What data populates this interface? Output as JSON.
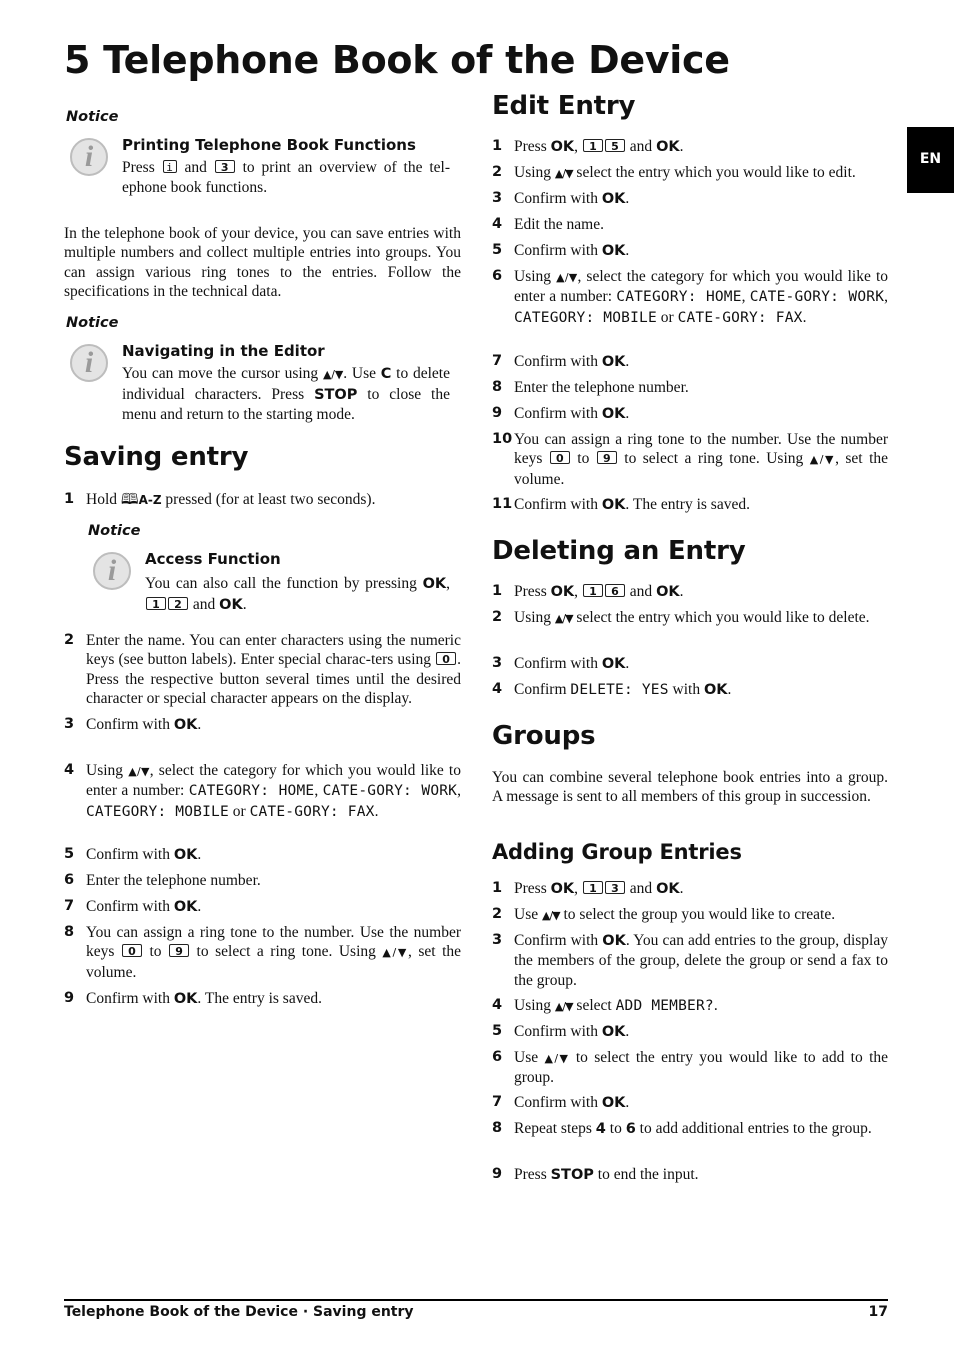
{
  "page_title": "5  Telephone Book of the Device",
  "lang_tab": "EN",
  "left": {
    "notice1": {
      "label": "Notice",
      "title": "Printing Telephone Book Functions",
      "body": [
        [
          "t",
          "Press "
        ],
        [
          "ks",
          "i"
        ],
        [
          "t",
          " and "
        ],
        [
          "k",
          "3"
        ],
        [
          "t",
          " to print an overview of the tel-ephone book functions."
        ]
      ]
    },
    "intro": "In the telephone book of your device, you can save entries with multiple numbers and collect multiple entries into groups. You can assign various ring tones to the entries. Follow the specifications in the technical data.",
    "notice2": {
      "label": "Notice",
      "title": "Navigating in the Editor",
      "body": [
        [
          "t",
          "You can move the cursor using "
        ],
        [
          "a",
          "▲/▼"
        ],
        [
          "t",
          ". Use "
        ],
        [
          "b",
          "C"
        ],
        [
          "t",
          " to delete individual characters. Press "
        ],
        [
          "b",
          "STOP"
        ],
        [
          "t",
          " to close the menu and return to the starting mode."
        ]
      ]
    },
    "saving": {
      "heading": "Saving entry",
      "step1": {
        "num": "1",
        "text": [
          [
            "t",
            "Hold "
          ],
          [
            "book",
            "🕮"
          ],
          [
            "az",
            "A-Z"
          ],
          [
            "t",
            " pressed (for at least two seconds)."
          ]
        ]
      },
      "notice3": {
        "label": "Notice",
        "title": "Access Function",
        "body": [
          [
            "t",
            "You can also call the function by pressing "
          ],
          [
            "b",
            "OK"
          ],
          [
            "t",
            ", "
          ],
          [
            "k",
            "1"
          ],
          [
            "k",
            "2"
          ],
          [
            "t",
            " and "
          ],
          [
            "b",
            "OK"
          ],
          [
            "t",
            "."
          ]
        ]
      },
      "steps": [
        {
          "num": "2",
          "text": [
            [
              "t",
              "Enter the name. You can enter characters using the numeric keys (see button labels).  Enter special charac-ters using "
            ],
            [
              "k",
              "0"
            ],
            [
              "t",
              ". Press the respective button several times until the desired character or special character appears on the display."
            ]
          ]
        },
        {
          "num": "3",
          "text": [
            [
              "t",
              "Confirm with "
            ],
            [
              "b",
              "OK"
            ],
            [
              "t",
              "."
            ]
          ]
        },
        {
          "num": "4",
          "text": [
            [
              "t",
              "Using "
            ],
            [
              "a",
              "▲/▼"
            ],
            [
              "t",
              ", select the category for which you would like to enter a number: "
            ],
            [
              "m",
              "CATEGORY:  HOME"
            ],
            [
              "t",
              ", "
            ],
            [
              "m",
              "CATE-GORY: WORK"
            ],
            [
              "t",
              ", "
            ],
            [
              "m",
              "CATEGORY: MOBILE"
            ],
            [
              "t",
              " or "
            ],
            [
              "m",
              "CATE-GORY: FAX"
            ],
            [
              "t",
              "."
            ]
          ]
        },
        {
          "num": "5",
          "text": [
            [
              "t",
              "Confirm with "
            ],
            [
              "b",
              "OK"
            ],
            [
              "t",
              "."
            ]
          ]
        },
        {
          "num": "6",
          "text": [
            [
              "t",
              "Enter the telephone number."
            ]
          ]
        },
        {
          "num": "7",
          "text": [
            [
              "t",
              "Confirm with "
            ],
            [
              "b",
              "OK"
            ],
            [
              "t",
              "."
            ]
          ]
        },
        {
          "num": "8",
          "text": [
            [
              "t",
              "You can assign a ring tone to the number. Use the number keys "
            ],
            [
              "k",
              "0"
            ],
            [
              "t",
              " to "
            ],
            [
              "k",
              "9"
            ],
            [
              "t",
              " to select a ring tone. Using "
            ],
            [
              "a",
              "▲/▼"
            ],
            [
              "t",
              ", set the volume."
            ]
          ]
        },
        {
          "num": "9",
          "text": [
            [
              "t",
              "Confirm with "
            ],
            [
              "b",
              "OK"
            ],
            [
              "t",
              ". The entry is saved."
            ]
          ]
        }
      ]
    }
  },
  "right": {
    "edit": {
      "heading": "Edit Entry",
      "steps": [
        {
          "num": "1",
          "text": [
            [
              "t",
              "Press "
            ],
            [
              "b",
              "OK"
            ],
            [
              "t",
              ", "
            ],
            [
              "k",
              "1"
            ],
            [
              "k",
              "5"
            ],
            [
              "t",
              " and "
            ],
            [
              "b",
              "OK"
            ],
            [
              "t",
              "."
            ]
          ]
        },
        {
          "num": "2",
          "text": [
            [
              "t",
              "Using "
            ],
            [
              "a",
              "▲/▼"
            ],
            [
              "t",
              " select the entry which you would like to edit."
            ]
          ]
        },
        {
          "num": "3",
          "text": [
            [
              "t",
              "Confirm with "
            ],
            [
              "b",
              "OK"
            ],
            [
              "t",
              "."
            ]
          ]
        },
        {
          "num": "4",
          "text": [
            [
              "t",
              "Edit the name."
            ]
          ]
        },
        {
          "num": "5",
          "text": [
            [
              "t",
              "Confirm with "
            ],
            [
              "b",
              "OK"
            ],
            [
              "t",
              "."
            ]
          ]
        },
        {
          "num": "6",
          "text": [
            [
              "t",
              "Using "
            ],
            [
              "a",
              "▲/▼"
            ],
            [
              "t",
              ", select the category for which you would like to enter a number: "
            ],
            [
              "m",
              "CATEGORY:  HOME"
            ],
            [
              "t",
              ", "
            ],
            [
              "m",
              "CATE-GORY: WORK"
            ],
            [
              "t",
              ", "
            ],
            [
              "m",
              "CATEGORY: MOBILE"
            ],
            [
              "t",
              " or "
            ],
            [
              "m",
              "CATE-GORY: FAX"
            ],
            [
              "t",
              "."
            ]
          ]
        },
        {
          "num": "7",
          "text": [
            [
              "t",
              "Confirm with "
            ],
            [
              "b",
              "OK"
            ],
            [
              "t",
              "."
            ]
          ]
        },
        {
          "num": "8",
          "text": [
            [
              "t",
              "Enter the telephone number."
            ]
          ]
        },
        {
          "num": "9",
          "text": [
            [
              "t",
              "Confirm with "
            ],
            [
              "b",
              "OK"
            ],
            [
              "t",
              "."
            ]
          ]
        },
        {
          "num": "10",
          "text": [
            [
              "t",
              "You can assign a ring tone to the number. Use the number keys "
            ],
            [
              "k",
              "0"
            ],
            [
              "t",
              " to "
            ],
            [
              "k",
              "9"
            ],
            [
              "t",
              " to select a ring tone. Using "
            ],
            [
              "a",
              "▲/▼"
            ],
            [
              "t",
              ", set the volume."
            ]
          ]
        },
        {
          "num": "11",
          "text": [
            [
              "t",
              "Confirm with "
            ],
            [
              "b",
              "OK"
            ],
            [
              "t",
              ". The entry is saved."
            ]
          ]
        }
      ]
    },
    "delete": {
      "heading": "Deleting an Entry",
      "steps": [
        {
          "num": "1",
          "text": [
            [
              "t",
              "Press "
            ],
            [
              "b",
              "OK"
            ],
            [
              "t",
              ", "
            ],
            [
              "k",
              "1"
            ],
            [
              "k",
              "6"
            ],
            [
              "t",
              " and "
            ],
            [
              "b",
              "OK"
            ],
            [
              "t",
              "."
            ]
          ]
        },
        {
          "num": "2",
          "text": [
            [
              "t",
              "Using "
            ],
            [
              "a",
              "▲/▼"
            ],
            [
              "t",
              " select the entry which you would like to delete."
            ]
          ]
        },
        {
          "num": "3",
          "text": [
            [
              "t",
              "Confirm with "
            ],
            [
              "b",
              "OK"
            ],
            [
              "t",
              "."
            ]
          ]
        },
        {
          "num": "4",
          "text": [
            [
              "t",
              "Confirm "
            ],
            [
              "m",
              "DELETE: YES"
            ],
            [
              "t",
              " with "
            ],
            [
              "b",
              "OK"
            ],
            [
              "t",
              "."
            ]
          ]
        }
      ]
    },
    "groups": {
      "heading": "Groups",
      "intro": "You can combine several telephone book entries into a group. A message is sent to all members of this group in succession.",
      "subheading": "Adding Group Entries",
      "steps": [
        {
          "num": "1",
          "text": [
            [
              "t",
              "Press "
            ],
            [
              "b",
              "OK"
            ],
            [
              "t",
              ", "
            ],
            [
              "k",
              "1"
            ],
            [
              "k",
              "3"
            ],
            [
              "t",
              " and "
            ],
            [
              "b",
              "OK"
            ],
            [
              "t",
              "."
            ]
          ]
        },
        {
          "num": "2",
          "text": [
            [
              "t",
              "Use "
            ],
            [
              "a",
              "▲/▼"
            ],
            [
              "t",
              " to select the group you would like to create."
            ]
          ]
        },
        {
          "num": "3",
          "text": [
            [
              "t",
              "Confirm with "
            ],
            [
              "b",
              "OK"
            ],
            [
              "t",
              ". You can add entries to the group, display the members of the group, delete the group or send a fax to the group."
            ]
          ]
        },
        {
          "num": "4",
          "text": [
            [
              "t",
              "Using "
            ],
            [
              "a",
              "▲/▼"
            ],
            [
              "t",
              " select "
            ],
            [
              "m",
              "ADD MEMBER?"
            ],
            [
              "t",
              "."
            ]
          ]
        },
        {
          "num": "5",
          "text": [
            [
              "t",
              "Confirm with "
            ],
            [
              "b",
              "OK"
            ],
            [
              "t",
              "."
            ]
          ]
        },
        {
          "num": "6",
          "text": [
            [
              "t",
              "Use "
            ],
            [
              "a",
              "▲/▼"
            ],
            [
              "t",
              " to select the entry you would like to add to the group."
            ]
          ]
        },
        {
          "num": "7",
          "text": [
            [
              "t",
              "Confirm with "
            ],
            [
              "b",
              "OK"
            ],
            [
              "t",
              "."
            ]
          ]
        },
        {
          "num": "8",
          "text": [
            [
              "t",
              "Repeat steps "
            ],
            [
              "b",
              "4"
            ],
            [
              "t",
              " to "
            ],
            [
              "b",
              "6"
            ],
            [
              "t",
              " to add additional entries to the group."
            ]
          ]
        },
        {
          "num": "9",
          "text": [
            [
              "t",
              "Press "
            ],
            [
              "b",
              "STOP"
            ],
            [
              "t",
              " to end the input."
            ]
          ]
        }
      ]
    }
  },
  "footer": {
    "breadcrumb": "Telephone Book of the Device  · Saving entry",
    "page_number": "17"
  }
}
